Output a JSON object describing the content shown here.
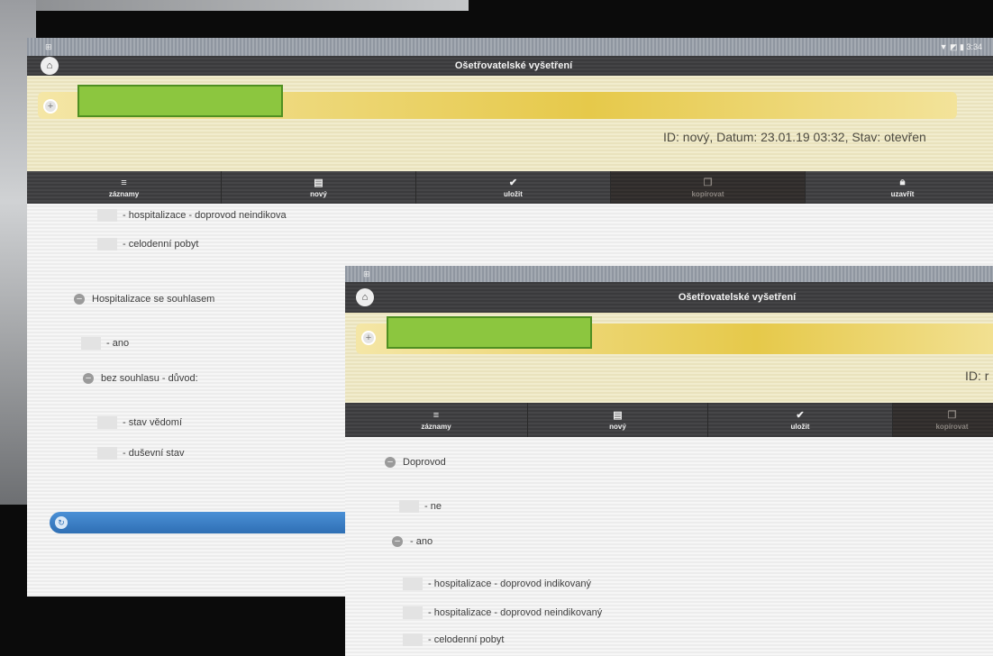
{
  "status_time": "3:34",
  "screen_title": "Ošetřovatelské vyšetření",
  "record_meta": "ID: nový, Datum: 23.01.19 03:32, Stav: otevřen",
  "record_meta_partial": "ID: r",
  "toolbar": {
    "records": "záznamy",
    "new": "nový",
    "save": "uložit",
    "copy": "kopírovat",
    "close": "uzavřít"
  },
  "screen1_items": {
    "doprovod_neindikovany": "- hospitalizace - doprovod neindikova",
    "celodenni_pobyt": "- celodenní pobyt",
    "hospitalizace_souhlas": "Hospitalizace se souhlasem",
    "ano": "- ano",
    "bez_souhlasu": "bez souhlasu - důvod:",
    "stav_vedomi": "- stav vědomí",
    "dusevni_stav": "- duševní stav"
  },
  "screen2_items": {
    "doprovod": "Doprovod",
    "ne": "- ne",
    "ano": "- ano",
    "doprovod_indikovany": "- hospitalizace - doprovod indikovaný",
    "doprovod_neindikovany": "- hospitalizace - doprovod neindikovaný",
    "celodenni_pobyt": "- celodenní pobyt"
  },
  "colors": {
    "redaction": "#8cc63f",
    "patient_bar": "#e6c94a",
    "accent_blue": "#2f6fb4"
  },
  "icons": [
    "home-icon",
    "plus-icon",
    "list-icon",
    "document-icon",
    "check-icon",
    "copy-icon",
    "lock-icon",
    "minus-icon",
    "refresh-icon"
  ]
}
